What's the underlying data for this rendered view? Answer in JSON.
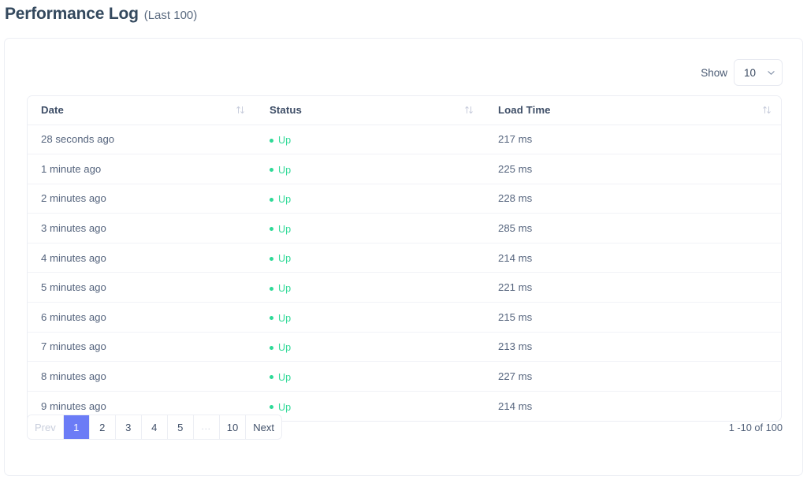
{
  "header": {
    "title_main": "Performance Log",
    "title_sub": "(Last 100)"
  },
  "toolbar": {
    "show_label": "Show",
    "per_page_value": "10",
    "chevron_icon": "chevron-down-icon"
  },
  "table": {
    "columns": [
      {
        "label": "Date",
        "sort_icon": "sort-arrows-icon"
      },
      {
        "label": "Status",
        "sort_icon": "sort-arrows-icon"
      },
      {
        "label": "Load Time",
        "sort_icon": "sort-arrows-icon"
      }
    ],
    "rows": [
      {
        "date": "28 seconds ago",
        "status": "Up",
        "load_time": "217 ms"
      },
      {
        "date": "1 minute ago",
        "status": "Up",
        "load_time": "225 ms"
      },
      {
        "date": "2 minutes ago",
        "status": "Up",
        "load_time": "228 ms"
      },
      {
        "date": "3 minutes ago",
        "status": "Up",
        "load_time": "285 ms"
      },
      {
        "date": "4 minutes ago",
        "status": "Up",
        "load_time": "214 ms"
      },
      {
        "date": "5 minutes ago",
        "status": "Up",
        "load_time": "221 ms"
      },
      {
        "date": "6 minutes ago",
        "status": "Up",
        "load_time": "215 ms"
      },
      {
        "date": "7 minutes ago",
        "status": "Up",
        "load_time": "213 ms"
      },
      {
        "date": "8 minutes ago",
        "status": "Up",
        "load_time": "227 ms"
      },
      {
        "date": "9 minutes ago",
        "status": "Up",
        "load_time": "214 ms"
      }
    ]
  },
  "pagination": {
    "buttons": [
      {
        "label": "Prev",
        "state": "disabled"
      },
      {
        "label": "1",
        "state": "active"
      },
      {
        "label": "2",
        "state": "normal"
      },
      {
        "label": "3",
        "state": "normal"
      },
      {
        "label": "4",
        "state": "normal"
      },
      {
        "label": "5",
        "state": "normal"
      },
      {
        "label": "...",
        "state": "ellipsis"
      },
      {
        "label": "10",
        "state": "normal"
      },
      {
        "label": "Next",
        "state": "normal"
      }
    ],
    "range_text": "1 -10 of 100"
  },
  "colors": {
    "accent": "#6b7cf6",
    "status_up": "#2fd997",
    "heading": "#34495e",
    "text": "#56657e",
    "border": "#eceef4"
  }
}
